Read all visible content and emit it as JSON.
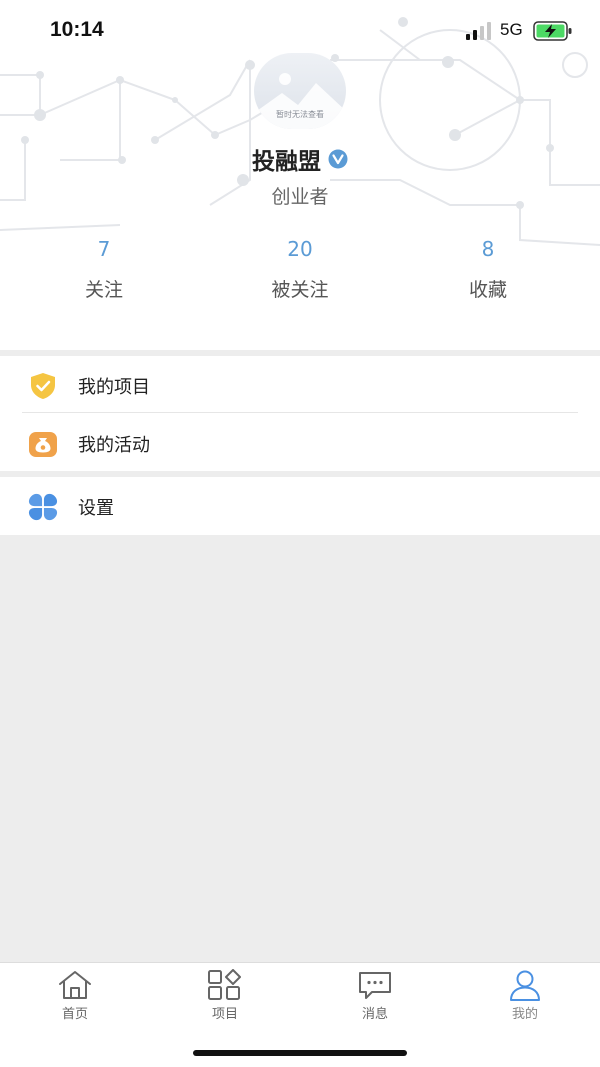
{
  "status_bar": {
    "time": "10:14",
    "network": "5G"
  },
  "profile": {
    "avatar_caption": "暂时无法查看",
    "name": "投融盟",
    "role": "创业者"
  },
  "stats": [
    {
      "value": "7",
      "label": "关注"
    },
    {
      "value": "20",
      "label": "被关注"
    },
    {
      "value": "8",
      "label": "收藏"
    }
  ],
  "menu": {
    "my_projects": "我的项目",
    "my_events": "我的活动",
    "settings": "设置"
  },
  "tabs": [
    {
      "label": "首页"
    },
    {
      "label": "项目"
    },
    {
      "label": "消息"
    },
    {
      "label": "我的"
    }
  ],
  "colors": {
    "accent": "#5b9bd5",
    "shield": "#f5c542",
    "activity": "#f0a24a",
    "settings": "#4a90e2",
    "background": "#ededed"
  }
}
